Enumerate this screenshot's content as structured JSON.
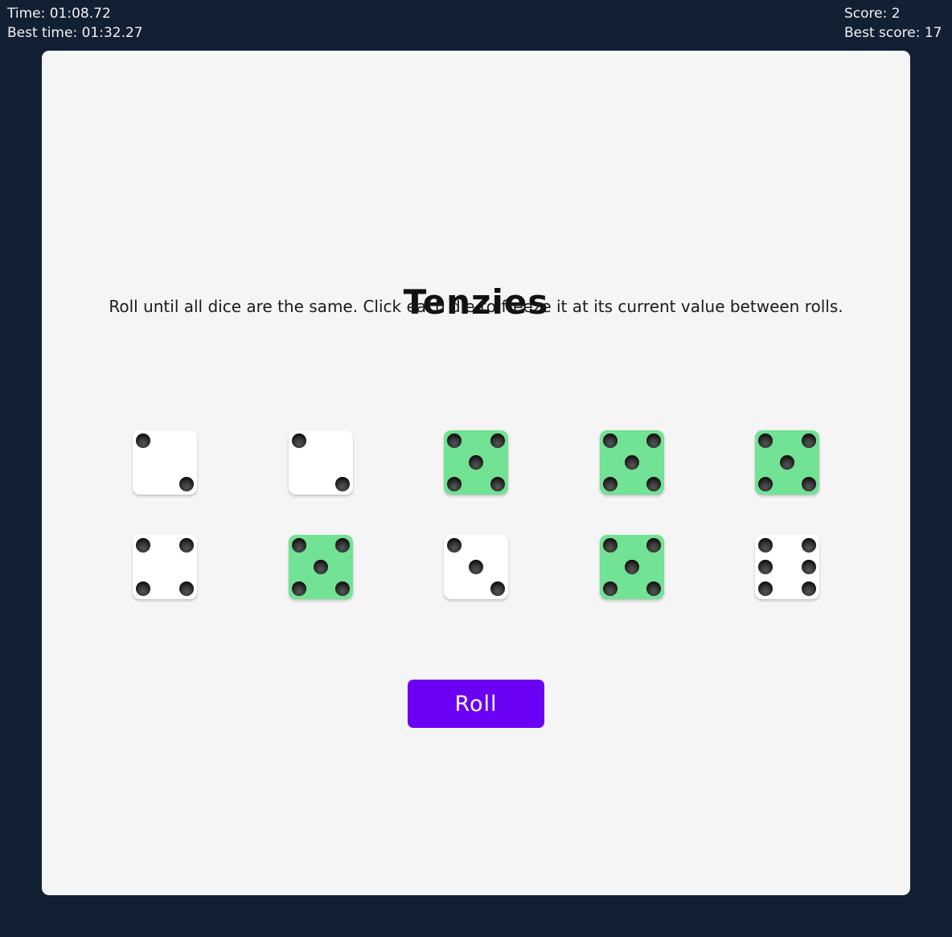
{
  "hud": {
    "time": "Time: 01:08.72",
    "best_time": "Best time: 01:32.27",
    "score": "Score: 2",
    "best_score": "Best score: 17"
  },
  "game": {
    "title": "Tenzies",
    "instructions": "Roll until all dice are the same. Click each die to freeze it at its current value between rolls.",
    "roll_label": "Roll"
  },
  "colors": {
    "background": "#122033",
    "board": "#f5f5f5",
    "held_die": "#72e294",
    "die": "#ffffff",
    "button": "#6a00f4"
  },
  "dice": [
    {
      "value": 2,
      "held": false
    },
    {
      "value": 2,
      "held": false
    },
    {
      "value": 5,
      "held": true
    },
    {
      "value": 5,
      "held": true
    },
    {
      "value": 5,
      "held": true
    },
    {
      "value": 4,
      "held": false
    },
    {
      "value": 5,
      "held": true
    },
    {
      "value": 3,
      "held": false
    },
    {
      "value": 5,
      "held": true
    },
    {
      "value": 6,
      "held": false
    }
  ]
}
